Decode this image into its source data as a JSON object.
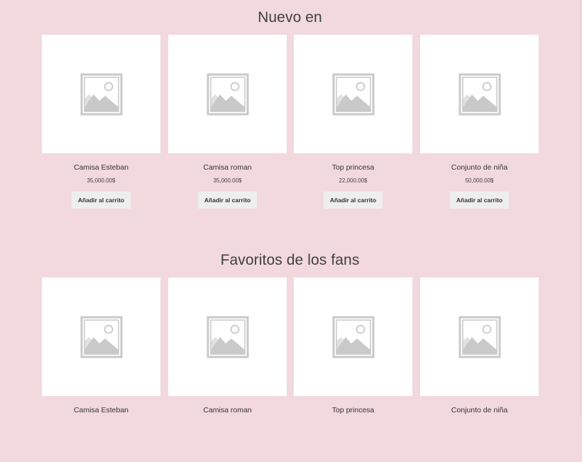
{
  "sections": [
    {
      "title": "Nuevo en",
      "products": [
        {
          "name": "Camisa Esteban",
          "price": "35,000.00$",
          "button": "Añadir al carrito",
          "image_icon": "placeholder-image-icon"
        },
        {
          "name": "Camisa roman",
          "price": "35,000.00$",
          "button": "Añadir al carrito",
          "image_icon": "placeholder-image-icon"
        },
        {
          "name": "Top princesa",
          "price": "22,000.00$",
          "button": "Añadir al carrito",
          "image_icon": "placeholder-image-icon"
        },
        {
          "name": "Conjunto de niña",
          "price": "50,000.00$",
          "button": "Añadir al carrito",
          "image_icon": "placeholder-image-icon"
        }
      ]
    },
    {
      "title": "Favoritos de los fans",
      "products": [
        {
          "name": "Camisa Esteban",
          "image_icon": "placeholder-image-icon"
        },
        {
          "name": "Camisa roman",
          "image_icon": "placeholder-image-icon"
        },
        {
          "name": "Top princesa",
          "image_icon": "placeholder-image-icon"
        },
        {
          "name": "Conjunto de niña",
          "image_icon": "placeholder-image-icon"
        }
      ]
    }
  ],
  "colors": {
    "page_background": "#f2d9de",
    "card_background": "#ffffff",
    "button_background": "#eeeeee",
    "placeholder_gray": "#c9c9c9"
  }
}
